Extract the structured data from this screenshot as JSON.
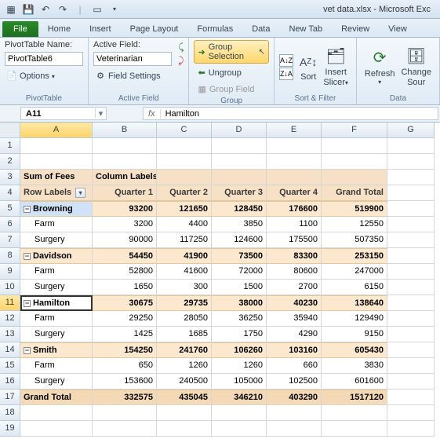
{
  "window": {
    "title": "vet data.xlsx - Microsoft Exc"
  },
  "tabs": {
    "file": "File",
    "items": [
      "Home",
      "Insert",
      "Page Layout",
      "Formulas",
      "Data",
      "New Tab",
      "Review",
      "View"
    ]
  },
  "ribbon": {
    "pivottable": {
      "name_label": "PivotTable Name:",
      "name_value": "PivotTable6",
      "options": "Options",
      "group": "PivotTable"
    },
    "activefield": {
      "label": "Active Field:",
      "value": "Veterinarian",
      "settings": "Field Settings",
      "group": "Active Field"
    },
    "group_grp": {
      "selection": "Group Selection",
      "ungroup": "Ungroup",
      "field": "Group Field",
      "group": "Group"
    },
    "sortfilter": {
      "sort": "Sort",
      "slicer_l1": "Insert",
      "slicer_l2": "Slicer",
      "group": "Sort & Filter"
    },
    "data": {
      "refresh": "Refresh",
      "change_l1": "Change",
      "change_l2": "Sour",
      "group": "Data"
    }
  },
  "namebox": "A11",
  "formula": "Hamilton",
  "columns": [
    "A",
    "B",
    "C",
    "D",
    "E",
    "F",
    "G"
  ],
  "pivot": {
    "measure": "Sum of Fees",
    "col_label": "Column Labels",
    "row_label": "Row Labels",
    "cols": [
      "Quarter 1",
      "Quarter 2",
      "Quarter 3",
      "Quarter 4",
      "Grand Total"
    ],
    "rows": [
      {
        "type": "sub",
        "label": "Browning",
        "vals": [
          "93200",
          "121650",
          "128450",
          "176600",
          "519900"
        ]
      },
      {
        "type": "det",
        "label": "Farm",
        "vals": [
          "3200",
          "4400",
          "3850",
          "1100",
          "12550"
        ]
      },
      {
        "type": "det",
        "label": "Surgery",
        "vals": [
          "90000",
          "117250",
          "124600",
          "175500",
          "507350"
        ]
      },
      {
        "type": "sub",
        "label": "Davidson",
        "vals": [
          "54450",
          "41900",
          "73500",
          "83300",
          "253150"
        ]
      },
      {
        "type": "det",
        "label": "Farm",
        "vals": [
          "52800",
          "41600",
          "72000",
          "80600",
          "247000"
        ]
      },
      {
        "type": "det",
        "label": "Surgery",
        "vals": [
          "1650",
          "300",
          "1500",
          "2700",
          "6150"
        ]
      },
      {
        "type": "sub",
        "label": "Hamilton",
        "vals": [
          "30675",
          "29735",
          "38000",
          "40230",
          "138640"
        ]
      },
      {
        "type": "det",
        "label": "Farm",
        "vals": [
          "29250",
          "28050",
          "36250",
          "35940",
          "129490"
        ]
      },
      {
        "type": "det",
        "label": "Surgery",
        "vals": [
          "1425",
          "1685",
          "1750",
          "4290",
          "9150"
        ]
      },
      {
        "type": "sub",
        "label": "Smith",
        "vals": [
          "154250",
          "241760",
          "106260",
          "103160",
          "605430"
        ]
      },
      {
        "type": "det",
        "label": "Farm",
        "vals": [
          "650",
          "1260",
          "1260",
          "660",
          "3830"
        ]
      },
      {
        "type": "det",
        "label": "Surgery",
        "vals": [
          "153600",
          "240500",
          "105000",
          "102500",
          "601600"
        ]
      }
    ],
    "grand": {
      "label": "Grand Total",
      "vals": [
        "332575",
        "435045",
        "346210",
        "403290",
        "1517120"
      ]
    }
  },
  "chart_data": {
    "type": "table",
    "title": "Sum of Fees",
    "row_field": "Veterinarian / Category",
    "col_field": "Quarter",
    "columns": [
      "Quarter 1",
      "Quarter 2",
      "Quarter 3",
      "Quarter 4",
      "Grand Total"
    ],
    "rows": [
      {
        "label": "Browning",
        "values": [
          93200,
          121650,
          128450,
          176600,
          519900
        ]
      },
      {
        "label": "Browning / Farm",
        "values": [
          3200,
          4400,
          3850,
          1100,
          12550
        ]
      },
      {
        "label": "Browning / Surgery",
        "values": [
          90000,
          117250,
          124600,
          175500,
          507350
        ]
      },
      {
        "label": "Davidson",
        "values": [
          54450,
          41900,
          73500,
          83300,
          253150
        ]
      },
      {
        "label": "Davidson / Farm",
        "values": [
          52800,
          41600,
          72000,
          80600,
          247000
        ]
      },
      {
        "label": "Davidson / Surgery",
        "values": [
          1650,
          300,
          1500,
          2700,
          6150
        ]
      },
      {
        "label": "Hamilton",
        "values": [
          30675,
          29735,
          38000,
          40230,
          138640
        ]
      },
      {
        "label": "Hamilton / Farm",
        "values": [
          29250,
          28050,
          36250,
          35940,
          129490
        ]
      },
      {
        "label": "Hamilton / Surgery",
        "values": [
          1425,
          1685,
          1750,
          4290,
          9150
        ]
      },
      {
        "label": "Smith",
        "values": [
          154250,
          241760,
          106260,
          103160,
          605430
        ]
      },
      {
        "label": "Smith / Farm",
        "values": [
          650,
          1260,
          1260,
          660,
          3830
        ]
      },
      {
        "label": "Smith / Surgery",
        "values": [
          153600,
          240500,
          105000,
          102500,
          601600
        ]
      },
      {
        "label": "Grand Total",
        "values": [
          332575,
          435045,
          346210,
          403290,
          1517120
        ]
      }
    ]
  }
}
